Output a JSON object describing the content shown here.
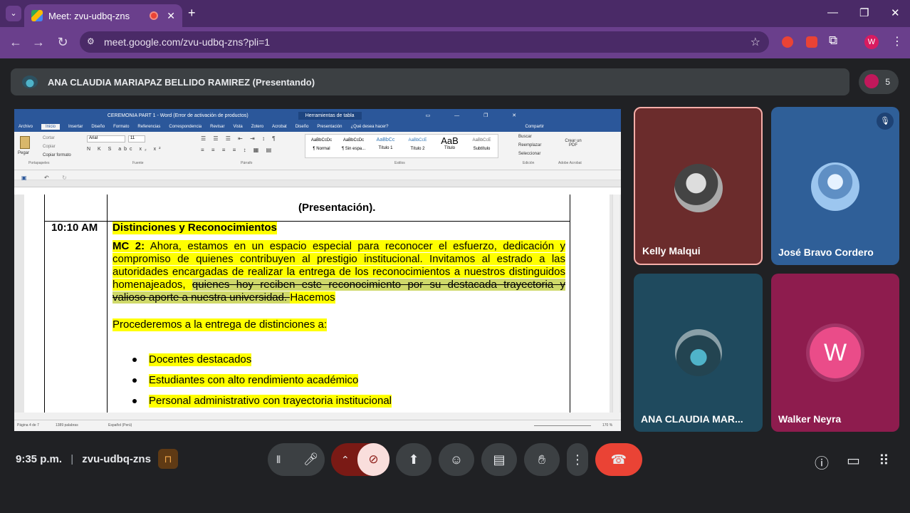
{
  "browser": {
    "tab_title": "Meet: zvu-udbq-zns",
    "url": "meet.google.com/zvu-udbq-zns?pli=1",
    "profile_initial": "W",
    "colors": {
      "frame": "#4a2a67",
      "toolbar": "#6a3f8c"
    }
  },
  "meet": {
    "presenter_label": "ANA CLAUDIA MARIAPAZ BELLIDO RAMIREZ (Presentando)",
    "participant_count": "5",
    "time": "9:35 p.m.",
    "separator": "|",
    "meeting_code": "zvu-udbq-zns"
  },
  "word": {
    "title": "CEREMONIA PART 1 - Word (Error de activación de productos)",
    "tools_label": "Herramientas de tabla",
    "tabs": [
      "Archivo",
      "Inicio",
      "Insertar",
      "Diseño",
      "Formato",
      "Referencias",
      "Correspondencia",
      "Revisar",
      "Vista",
      "Zotero",
      "Acrobat",
      "Diseño",
      "Presentación",
      "¿Qué desea hacer?",
      "Compartir"
    ],
    "ribbon_groups": [
      "Portapapeles",
      "Fuente",
      "Párrafo",
      "Estilos",
      "Edición",
      "Adobe Acrobat"
    ],
    "clipboard": [
      "Pegar",
      "Cortar",
      "Copiar",
      "Copiar formato"
    ],
    "font_name": "Arial",
    "font_size": "11",
    "styles": [
      {
        "sample": "AaBbCcDc",
        "name": "¶ Normal"
      },
      {
        "sample": "AaBbCcDc",
        "name": "¶ Sin espa..."
      },
      {
        "sample": "AaBbCc",
        "name": "Título 1"
      },
      {
        "sample": "AaBbCcE",
        "name": "Título 2"
      },
      {
        "sample": "AaB",
        "name": "Título"
      },
      {
        "sample": "AaBbCcE",
        "name": "Subtítulo"
      }
    ],
    "editing": [
      "Buscar",
      "Reemplazar",
      "Seleccionar"
    ],
    "pdf_button": "Crear un PDF",
    "status_left": [
      "Página 4 de 7",
      "1389 palabras",
      "Español (Perú)"
    ],
    "zoom": "170 %",
    "doc": {
      "header_fragment": "(Presentación).",
      "time": "10:10 AM",
      "heading": "Distinciones y Reconocimientos",
      "mc_label": "MC 2:",
      "p1_lines": [
        " Ahora, estamos en un espacio especial para reconocer el esfuerzo, dedicación y",
        "compromiso de quienes contribuyen al prestigio institucional. Invitamos al estrado a las",
        "autoridades encargadas de realizar la entrega de los reconocimientos a nuestros distinguidos"
      ],
      "p1_line4_plain": "homenajeados, ",
      "p1_line4_strike": "quienes hoy reciben este reconocimiento por su destacada trayectoria y",
      "p1_line5_strike": "valioso aporte a nuestra universidad. ",
      "p1_line5_plain": "Hacemos",
      "p2": "Procederemos a la entrega de distinciones a:",
      "bullets": [
        "Docentes destacados",
        "Estudiantes con alto rendimiento académico",
        "Personal administrativo con trayectoria institucional"
      ]
    }
  },
  "tiles": [
    {
      "name": "Kelly Malqui",
      "bg": "#6b2c2c"
    },
    {
      "name": "José Bravo Cordero",
      "bg": "#2f5f98"
    },
    {
      "name": "ANA CLAUDIA MAR...",
      "bg": "#1f4a5e"
    },
    {
      "name": "Walker Neyra",
      "bg": "#8e1c4e",
      "initial": "W"
    }
  ],
  "icons": {
    "mic_muted": "mic-off-icon",
    "camera_off": "camera-off-icon",
    "present": "present-icon",
    "emoji": "emoji-icon",
    "captions": "captions-icon",
    "hand": "raise-hand-icon",
    "more": "more-icon",
    "end": "end-call-icon",
    "info": "info-icon",
    "chat": "chat-icon",
    "activities": "activities-icon"
  }
}
